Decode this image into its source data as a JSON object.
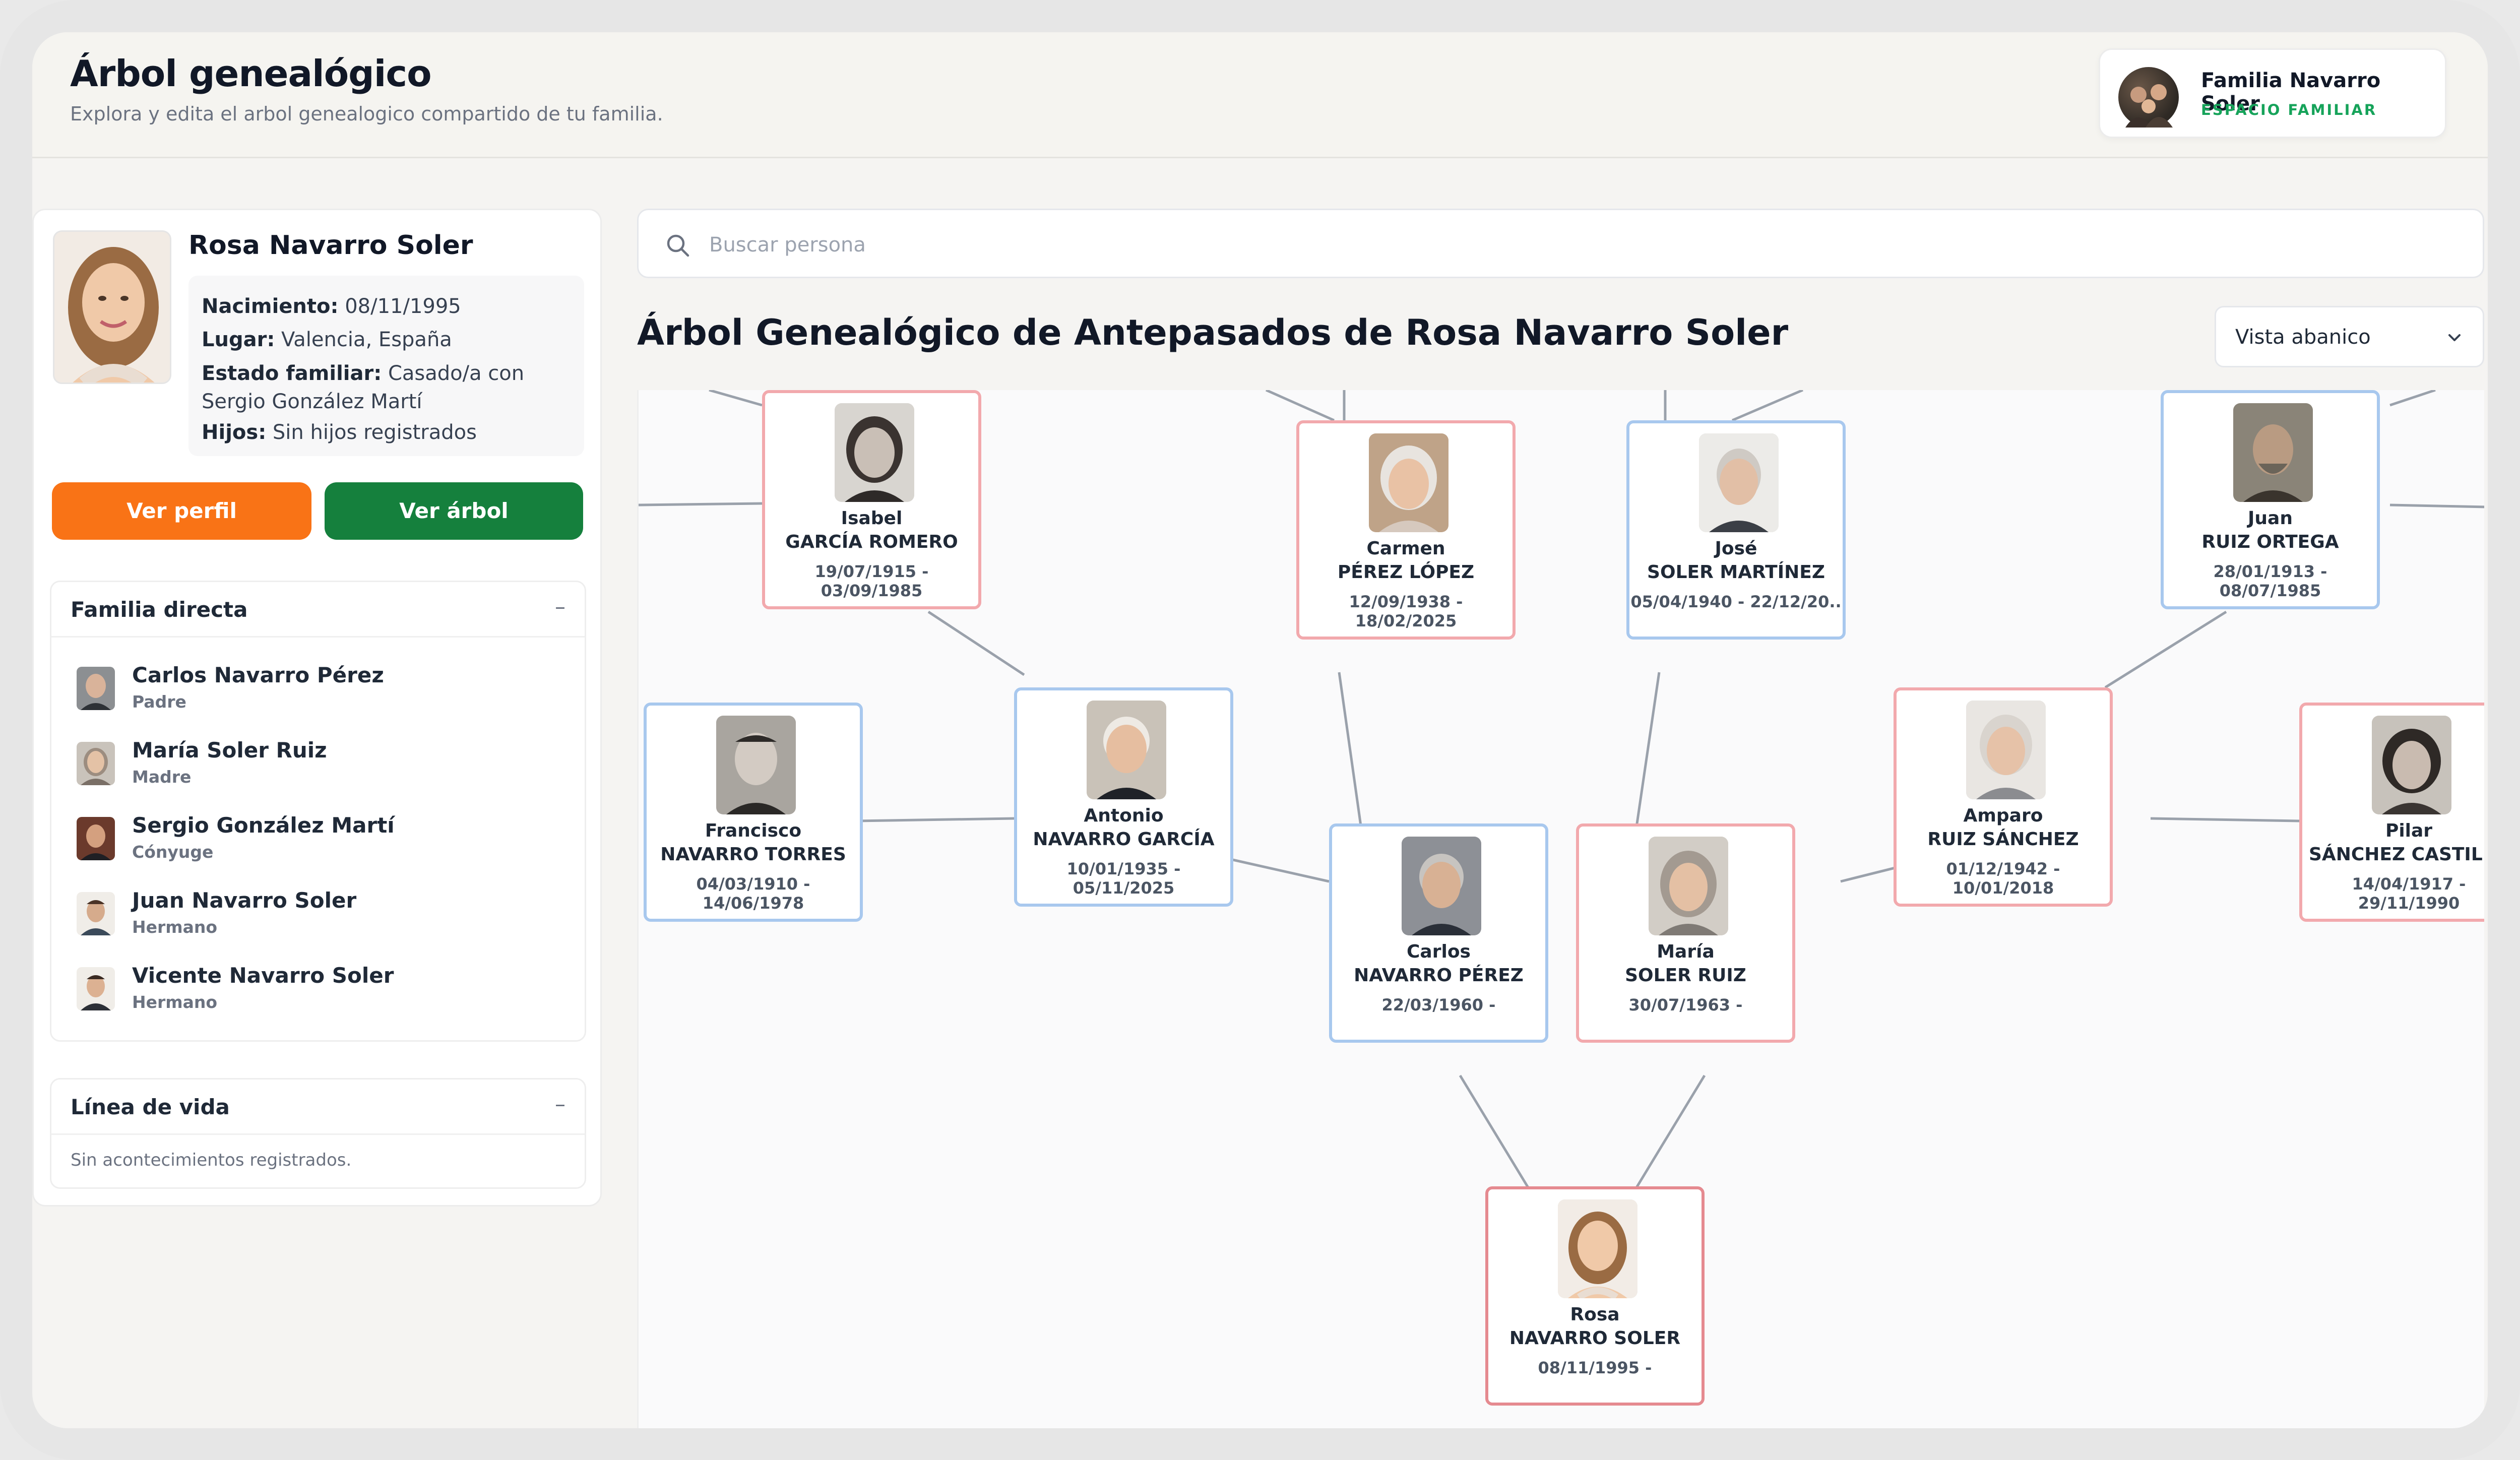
{
  "header": {
    "title": "Árbol genealógico",
    "subtitle": "Explora y edita el arbol genealogico compartido de tu familia.",
    "family_name": "Familia Navarro Soler",
    "family_label": "ESPACIO FAMILIAR"
  },
  "profile": {
    "name": "Rosa Navarro Soler",
    "birth_label": "Nacimiento:",
    "birth_value": "08/11/1995",
    "place_label": "Lugar:",
    "place_value": "Valencia, España",
    "status_label": "Estado familiar:",
    "status_value": "Casado/a con",
    "status_value_2": "Sergio González Martí",
    "children_label": "Hijos:",
    "children_value": "Sin hijos registrados",
    "btn_profile": "Ver perfil",
    "btn_tree": "Ver árbol"
  },
  "family_section": {
    "title": "Familia directa",
    "toggle": "–",
    "members": [
      {
        "name": "Carlos Navarro Pérez",
        "relation": "Padre"
      },
      {
        "name": "María Soler Ruiz",
        "relation": "Madre"
      },
      {
        "name": "Sergio González Martí",
        "relation": "Cónyuge"
      },
      {
        "name": "Juan Navarro Soler",
        "relation": "Hermano"
      },
      {
        "name": "Vicente Navarro Soler",
        "relation": "Hermano"
      }
    ]
  },
  "lifeline_section": {
    "title": "Línea de vida",
    "toggle": "–",
    "empty": "Sin acontecimientos registrados."
  },
  "search": {
    "placeholder": "Buscar persona"
  },
  "tree": {
    "title": "Árbol Genealógico de Antepasados de Rosa Navarro Soler",
    "view_select": "Vista abanico",
    "persons": [
      {
        "first": "Isabel",
        "last": "GARCÍA ROMERO",
        "dates": "19/07/1915 - 03/09/1985"
      },
      {
        "first": "Carmen",
        "last": "PÉREZ LÓPEZ",
        "dates": "12/09/1938 - 18/02/2025"
      },
      {
        "first": "José",
        "last": "SOLER MARTÍNEZ",
        "dates": "05/04/1940 - 22/12/20.."
      },
      {
        "first": "Juan",
        "last": "RUIZ ORTEGA",
        "dates": "28/01/1913 - 08/07/1985"
      },
      {
        "first": "Francisco",
        "last": "NAVARRO TORRES",
        "dates": "04/03/1910 - 14/06/1978"
      },
      {
        "first": "Antonio",
        "last": "NAVARRO GARCÍA",
        "dates": "10/01/1935 - 05/11/2025"
      },
      {
        "first": "Amparo",
        "last": "RUIZ SÁNCHEZ",
        "dates": "01/12/1942 - 10/01/2018"
      },
      {
        "first": "Pilar",
        "last": "SÁNCHEZ CASTILLO",
        "dates": "14/04/1917 - 29/11/1990"
      },
      {
        "first": "Carlos",
        "last": "NAVARRO PÉREZ",
        "dates": "22/03/1960 -"
      },
      {
        "first": "María",
        "last": "SOLER RUIZ",
        "dates": "30/07/1963 -"
      },
      {
        "first": "Rosa",
        "last": "NAVARRO SOLER",
        "dates": "08/11/1995 -"
      }
    ]
  },
  "colors": {
    "female_border": "#f2a9ad",
    "male_border": "#a8c8ee",
    "btn_profile": "#f97316",
    "btn_tree": "#15803d",
    "accent_green": "#16a35a"
  }
}
